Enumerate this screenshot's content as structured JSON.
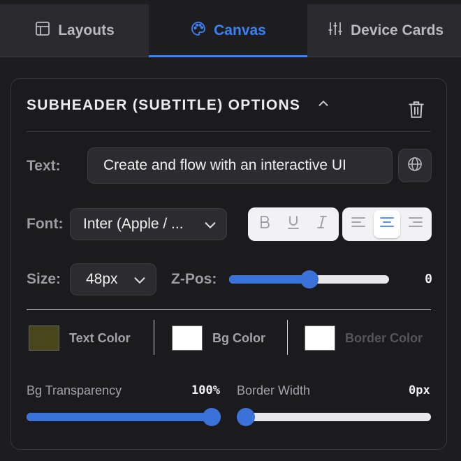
{
  "tabs": {
    "layouts": "Layouts",
    "canvas": "Canvas",
    "device_cards": "Device Cards",
    "active": "canvas"
  },
  "panel": {
    "title": "SUBHEADER (SUBTITLE) OPTIONS",
    "text_label": "Text:",
    "text_value": "Create and flow with an interactive UI",
    "font_label": "Font:",
    "font_value": "Inter (Apple / ...",
    "size_label": "Size:",
    "size_value": "48px",
    "zpos_label": "Z-Pos:",
    "zpos_value": "0",
    "zpos_fraction": 0.5,
    "style_buttons": [
      "B",
      "U",
      "I"
    ],
    "align_active": "center",
    "text_color_label": "Text Color",
    "text_color": "#4a461c",
    "bg_color_label": "Bg Color",
    "bg_color": "#ffffff",
    "border_color_label": "Border Color",
    "border_color": "#ffffff",
    "bg_transparency_label": "Bg Transparency",
    "bg_transparency_value": "100%",
    "bg_transparency_fraction": 1.0,
    "border_width_label": "Border Width",
    "border_width_value": "0px",
    "border_width_fraction": 0.0
  },
  "colors": {
    "accent": "#3b82f6",
    "slider": "#3b72d9"
  }
}
